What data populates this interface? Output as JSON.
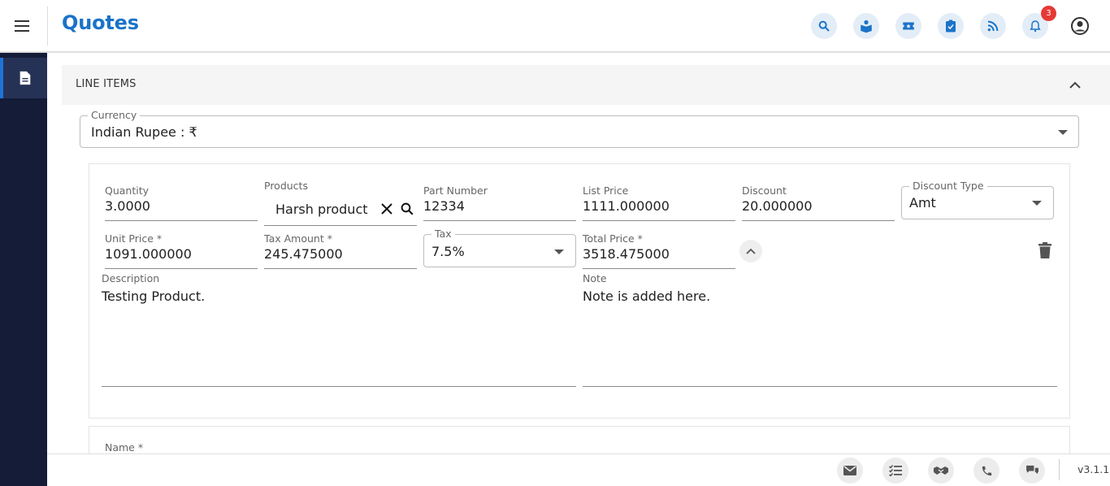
{
  "header": {
    "title": "Quotes",
    "notification_count": "3",
    "icons": [
      "search-icon",
      "knowledge-icon",
      "ticket-icon",
      "task-icon",
      "feed-icon",
      "bell-icon"
    ]
  },
  "panel": {
    "title": "LINE ITEMS"
  },
  "currency": {
    "label": "Currency",
    "value": "Indian Rupee : ₹"
  },
  "line_item": {
    "quantity_label": "Quantity",
    "quantity_value": "3.0000",
    "products_label": "Products",
    "products_value": "Harsh product",
    "part_number_label": "Part Number",
    "part_number_value": "12334",
    "list_price_label": "List Price",
    "list_price_value": "1111.000000",
    "discount_label": "Discount",
    "discount_value": "20.000000",
    "discount_type_label": "Discount Type",
    "discount_type_value": "Amt",
    "unit_price_label": "Unit Price *",
    "unit_price_value": "1091.000000",
    "tax_amount_label": "Tax Amount *",
    "tax_amount_value": "245.475000",
    "tax_label": "Tax",
    "tax_value": "7.5%",
    "total_price_label": "Total Price *",
    "total_price_value": "3518.475000",
    "description_label": "Description",
    "description_value": "Testing Product.",
    "note_label": "Note",
    "note_value": "Note is added here."
  },
  "second_item": {
    "name_label": "Name *"
  },
  "footer": {
    "icons": [
      "mail-icon",
      "checklist-icon",
      "handshake-icon",
      "phone-icon",
      "chat-icon"
    ],
    "version": "v3.1.1"
  },
  "colors": {
    "brand": "#1a73c8",
    "sidebar_bg": "#141c38",
    "badge": "#e53935"
  }
}
